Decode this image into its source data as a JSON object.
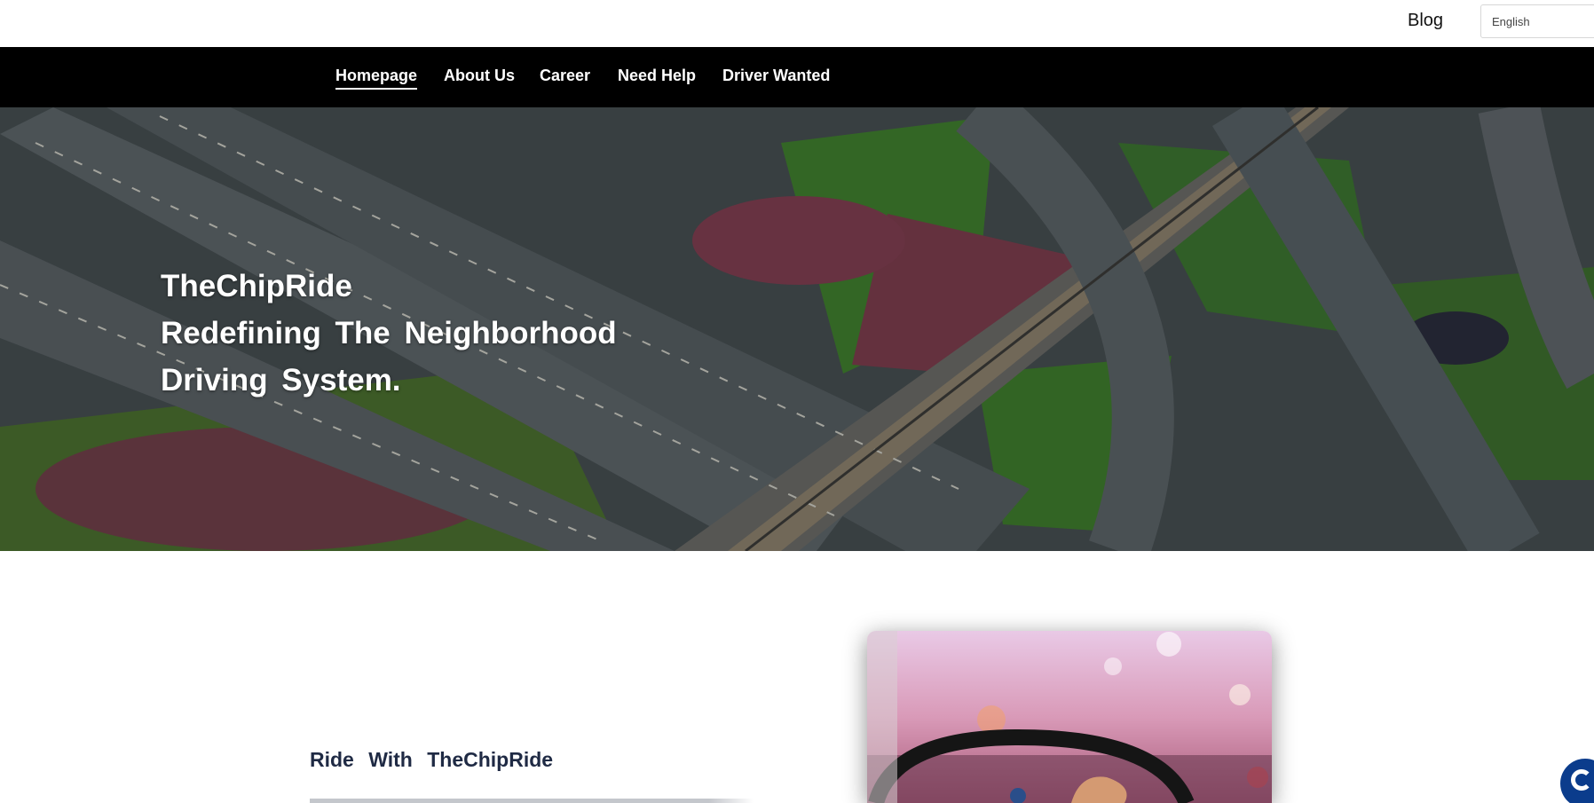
{
  "topbar": {
    "blog_label": "Blog",
    "language_selected": "English"
  },
  "nav": {
    "items": [
      {
        "label": "Homepage",
        "active": true
      },
      {
        "label": "About Us",
        "active": false
      },
      {
        "label": "Career",
        "active": false
      },
      {
        "label": "Need Help",
        "active": false
      },
      {
        "label": "Driver Wanted",
        "active": false
      }
    ]
  },
  "hero": {
    "line1": "TheChipRide",
    "line2": "Redefining The Neighborhood",
    "line3": "Driving System."
  },
  "intro": {
    "title": "Ride With TheChipRide"
  },
  "colors": {
    "nav_bg": "#000000",
    "heading": "#1f2a44",
    "chat": "#0b3c8c"
  },
  "icons": {
    "chat": "chat-bubble-icon"
  }
}
